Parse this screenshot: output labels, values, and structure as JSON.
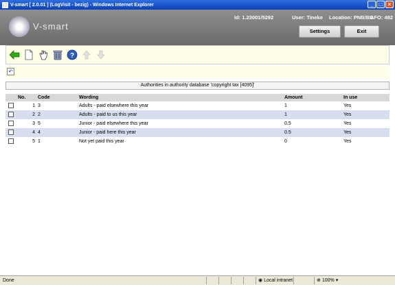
{
  "window": {
    "title": "V-smart [ 2.0.01 ] (LogVisit - bezig) - Windows Internet Explorer"
  },
  "header": {
    "logo": "V-smart",
    "id_label": "Id: 1.23001/5292",
    "user_label": "User: Tineke",
    "location_label": "Location: PNB/BD",
    "afo_label": "AFO: 482",
    "settings_label": "Settings",
    "exit_label": "Exit"
  },
  "caption": "Authorities in authority database 'copyright tax [4095]'",
  "table": {
    "columns": [
      "No.",
      "Code",
      "Wording",
      "Amount",
      "In use"
    ],
    "rows": [
      {
        "no": "1",
        "code": "3",
        "wording": "Adults - paid elsewhere this year",
        "amount": "1",
        "in_use": "Yes"
      },
      {
        "no": "2",
        "code": "2",
        "wording": "Adults - paid to us this year",
        "amount": "1",
        "in_use": "Yes"
      },
      {
        "no": "3",
        "code": "5",
        "wording": "Junior - paid elsewhere this year",
        "amount": "0.5",
        "in_use": "Yes"
      },
      {
        "no": "4",
        "code": "4",
        "wording": "Junior - paid here this year",
        "amount": "0.5",
        "in_use": "Yes"
      },
      {
        "no": "5",
        "code": "1",
        "wording": "Not yet paid this year",
        "amount": "0",
        "in_use": "Yes"
      }
    ]
  },
  "statusbar": {
    "status": "Done",
    "zone": "Local intranet",
    "zoom": "100%"
  },
  "icons": [
    "back-arrow-icon",
    "new-document-icon",
    "hand-select-icon",
    "trash-icon",
    "help-icon",
    "up-arrow-icon",
    "down-arrow-icon",
    "refresh-icon"
  ]
}
